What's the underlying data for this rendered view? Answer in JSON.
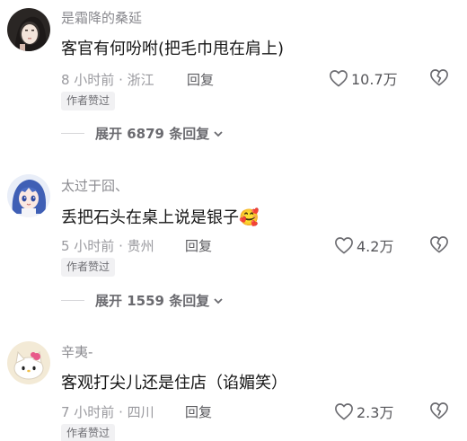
{
  "comments": [
    {
      "username": "是霜降的桑延",
      "text": "客官有何吩咐(把毛巾甩在肩上)",
      "meta": "8 小时前 · 浙江",
      "reply_label": "回复",
      "likes": "10.7万",
      "badge": "作者赞过",
      "expand_label": "展开 6879 条回复",
      "avatar_icon": "avatar-girl-dark-hair-icon"
    },
    {
      "username": "太过于囧、",
      "text": "丢把石头在桌上说是银子🥰",
      "meta": "5 小时前 · 贵州",
      "reply_label": "回复",
      "likes": "4.2万",
      "badge": "作者赞过",
      "expand_label": "展开 1559 条回复",
      "avatar_icon": "avatar-anime-blue-hair-icon"
    },
    {
      "username": "辛夷-",
      "text": "客观打尖儿还是住店（谄媚笑）",
      "meta": "7 小时前 · 四川",
      "reply_label": "回复",
      "likes": "2.3万",
      "badge": "作者赞过",
      "avatar_icon": "avatar-hello-kitty-icon"
    }
  ],
  "colors": {
    "username": "#8a8a8f",
    "text": "#161616",
    "meta": "#9a9a9f",
    "badge_bg": "#f1f1f3"
  }
}
